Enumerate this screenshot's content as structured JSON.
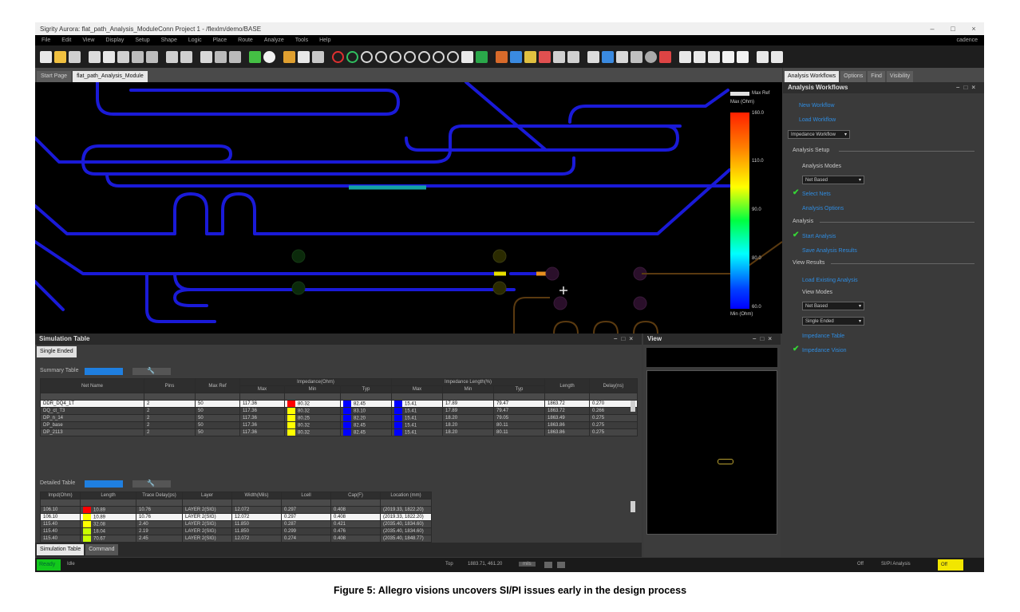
{
  "window": {
    "title": "Sigrity Aurora: flat_path_Analysis_ModuleConn Project 1 - /flexlm/demo/BASE",
    "controls": [
      "–",
      "□",
      "×"
    ]
  },
  "menubar": {
    "items": [
      "File",
      "Edit",
      "View",
      "Display",
      "Setup",
      "Shape",
      "Logic",
      "Place",
      "Route",
      "Analyze",
      "Tools",
      "Help"
    ],
    "brand": "cadence"
  },
  "toolbar": {
    "icons": [
      "open-icon",
      "save-icon",
      "print-icon",
      "move-icon",
      "copy-icon",
      "delete-icon",
      "undo-icon",
      "redo-icon",
      "pin-icon",
      "probe-icon",
      "route-icon",
      "grid-icon",
      "snap-icon",
      "measure-icon",
      "zoom-fit-icon",
      "zoom-in-icon",
      "zoom-out-icon",
      "zoom-prev-icon",
      "zoom-world-icon",
      "refresh-icon",
      "layers-icon",
      "color-icon",
      "shapes-icon",
      "3d-icon",
      "view-icon",
      "export-icon"
    ]
  },
  "doc_tabs": [
    "Start Page",
    "flat_path_Analysis_Module"
  ],
  "canvas": {
    "legend_top_label": "Max Ref",
    "legend_top_value": "Max (Ohm)",
    "legend_bottom_value": "Min (Ohm)",
    "scale_values": [
      "160.0",
      "110.0",
      "90.0",
      "80.0",
      "60.0"
    ],
    "colors": {
      "trace": "#1a1ad8",
      "highlight": "#14a3a3",
      "background": "#000000"
    }
  },
  "simulation_table": {
    "title": "Simulation Table",
    "tab": "Single Ended",
    "summary_label": "Summary Table",
    "detailed_label": "Detailed Table",
    "summary_groups": [
      "Impedance(Ohm)",
      "Impedance Length(%)"
    ],
    "summary_columns": [
      "Net Name",
      "Pins",
      "Max Ref",
      "Max",
      "Min",
      "Typ",
      "Max",
      "Min",
      "Typ",
      "Length",
      "Delay(ns)"
    ],
    "summary_rows": [
      {
        "net": "DDR_DQ4_1T",
        "pins": "2",
        "ref": "50",
        "max": "117.36",
        "min_color": "#ff0000",
        "min": "80.32",
        "typ_color": "#0000ff",
        "typ": "82.45",
        "lmax_color": "#0000ff",
        "lmax": "15.41",
        "lmin": "17.89",
        "ltyp": "79.47",
        "len": "1863.72",
        "delay": "0.270"
      },
      {
        "net": "DQ_ct_T3",
        "pins": "2",
        "ref": "50",
        "max": "117.36",
        "min_color": "#ffff00",
        "min": "80.32",
        "typ_color": "#0000ff",
        "typ": "83.10",
        "lmax_color": "#0000ff",
        "lmax": "15.41",
        "lmin": "17.89",
        "ltyp": "79.47",
        "len": "1863.72",
        "delay": "0.266"
      },
      {
        "net": "DP_n_14",
        "pins": "2",
        "ref": "50",
        "max": "117.36",
        "min_color": "#ffff00",
        "min": "80.25",
        "typ_color": "#0000ff",
        "typ": "82.20",
        "lmax_color": "#0000ff",
        "lmax": "15.41",
        "lmin": "18.20",
        "ltyp": "79.05",
        "len": "1863.49",
        "delay": "0.275"
      },
      {
        "net": "DP_base",
        "pins": "2",
        "ref": "50",
        "max": "117.36",
        "min_color": "#ffff00",
        "min": "80.32",
        "typ_color": "#0000ff",
        "typ": "82.45",
        "lmax_color": "#0000ff",
        "lmax": "15.41",
        "lmin": "18.20",
        "ltyp": "80.11",
        "len": "1863.86",
        "delay": "0.275"
      },
      {
        "net": "DP_2113",
        "pins": "2",
        "ref": "50",
        "max": "117.36",
        "min_color": "#ffff00",
        "min": "80.32",
        "typ_color": "#0000ff",
        "typ": "82.45",
        "lmax_color": "#0000ff",
        "lmax": "15.41",
        "lmin": "18.20",
        "ltyp": "80.11",
        "len": "1863.86",
        "delay": "0.275"
      }
    ],
    "detailed_columns": [
      "Impd(Ohm)",
      "Length",
      "Trace Delay(ps)",
      "Layer",
      "Width(Mils)",
      "Lcell",
      "Cap(F)",
      "Location (mm)"
    ],
    "detailed_rows": [
      {
        "impd": "106.10",
        "color": "#ff0000",
        "length": "10.89",
        "delay": "10.76",
        "layer": "LAYER 2(SIG)",
        "width": "12.072",
        "lcell": "0.297",
        "cap": "0.408",
        "loc": "(2019.33, 1822.20)"
      },
      {
        "impd": "106.10",
        "color": "#ffff00",
        "length": "10.89",
        "delay": "10.76",
        "layer": "LAYER 2(SIG)",
        "width": "12.072",
        "lcell": "0.297",
        "cap": "0.408",
        "loc": "(2019.33, 1822.20)"
      },
      {
        "impd": "115.40",
        "color": "#ffff00",
        "length": "32.08",
        "delay": "2.40",
        "layer": "LAYER 2(SIG)",
        "width": "11.850",
        "lcell": "0.287",
        "cap": "0.421",
        "loc": "(2035.40, 1834.60)"
      },
      {
        "impd": "115.40",
        "color": "#c8ff00",
        "length": "18.04",
        "delay": "2.19",
        "layer": "LAYER 2(SIG)",
        "width": "11.850",
        "lcell": "0.299",
        "cap": "0.476",
        "loc": "(2035.40, 1834.60)"
      },
      {
        "impd": "115.40",
        "color": "#c8ff00",
        "length": "70.67",
        "delay": "2.45",
        "layer": "LAYER 2(SIG)",
        "width": "12.072",
        "lcell": "0.274",
        "cap": "0.408",
        "loc": "(2035.40, 1848.77)"
      },
      {
        "impd": "115.40",
        "color": "#c8ff00",
        "length": "70.67",
        "delay": "2.45",
        "layer": "LAYER 2(SIG)",
        "width": "12.072",
        "lcell": "0.274",
        "cap": "0.420",
        "loc": "(2035.40, 1856.66)"
      }
    ]
  },
  "view_panel": {
    "title": "View"
  },
  "bottom_tabs": [
    "Simulation Table",
    "Command"
  ],
  "right_panel": {
    "tabs": [
      "Analysis Workflows",
      "Options",
      "Find",
      "Visibility"
    ],
    "title": "Analysis Workflows",
    "new_workflow": "New Workflow",
    "load_workflow": "Load Workflow",
    "workflow_select": "Impedance Workflow",
    "analysis_setup": "Analysis Setup",
    "analysis_modes": "Analysis Modes",
    "mode_select": "Net Based",
    "select_nets": "Select Nets",
    "analysis_options": "Analysis Options",
    "analysis": "Analysis",
    "start_analysis": "Start Analysis",
    "save_results": "Save Analysis Results",
    "view_results": "View Results",
    "load_existing": "Load Existing Analysis",
    "view_modes": "View Modes",
    "view_select_1": "Net Based",
    "view_select_2": "Single Ended",
    "impedance_table": "Impedance Table",
    "impedance_vision": "Impedance Vision"
  },
  "statusbar": {
    "ready": "Ready",
    "idle": "Idle",
    "layer": "Top",
    "coords": "1883.71, 461.20",
    "unit": "mils",
    "right_items": [
      "Off",
      "SI/PI Analysis"
    ],
    "badge": "Off"
  },
  "caption": "Figure 5: Allegro visions uncovers SI/PI issues early in the design process"
}
